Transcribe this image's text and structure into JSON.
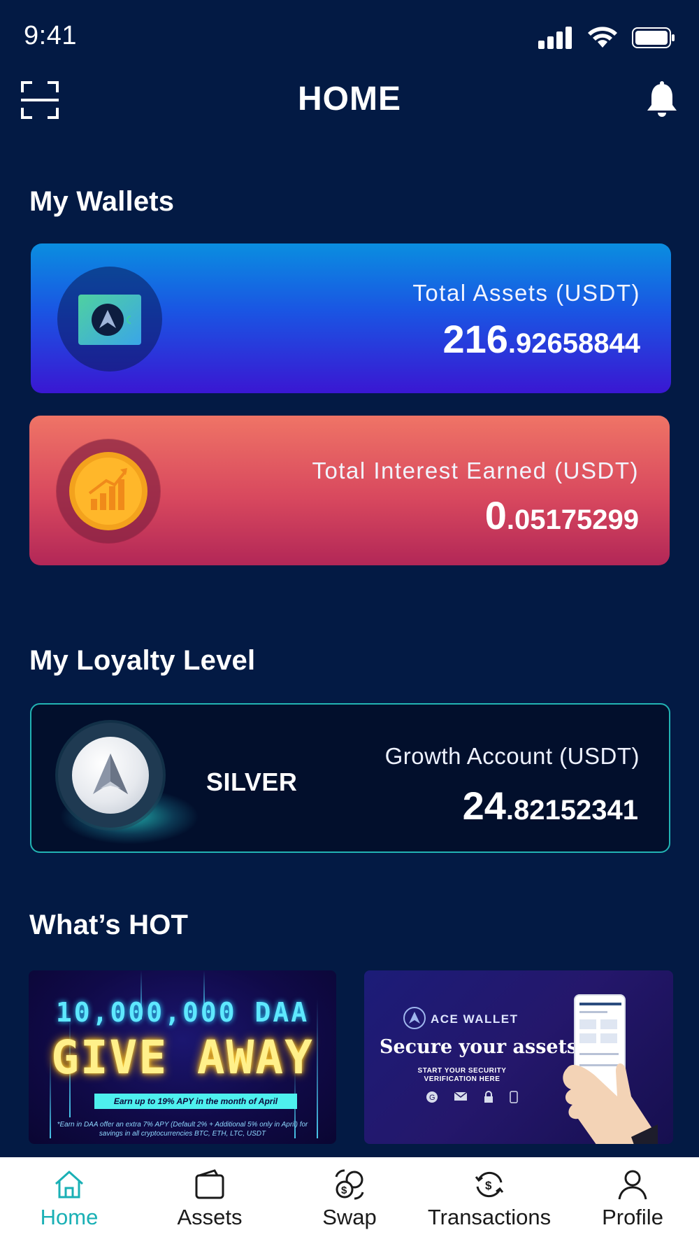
{
  "status_bar": {
    "time": "9:41"
  },
  "header": {
    "title": "HOME"
  },
  "sections": {
    "wallets_title": "My Wallets",
    "loyalty_title": "My Loyalty Level",
    "hot_title": "What’s HOT"
  },
  "wallets": {
    "total_assets": {
      "label": "Total Assets (USDT)",
      "int": "216",
      "dec": ".92658844"
    },
    "total_interest": {
      "label": "Total Interest Earned (USDT)",
      "int": "0",
      "dec": ".05175299"
    }
  },
  "loyalty": {
    "level": "SILVER",
    "label": "Growth Account (USDT)",
    "int": "24",
    "dec": ".82152341"
  },
  "hot": {
    "giveaway": {
      "top": "10,000,000 DAA",
      "main": "GIVE AWAY",
      "sub": "Earn up to 19% APY in the month of April",
      "note": "*Earn in DAA offer an extra 7% APY (Default 2% + Additional 5% only in April) for savings in all cryptocurrencies BTC, ETH, LTC, USDT"
    },
    "security": {
      "brand": "ACE WALLET",
      "headline": "Secure your assets.",
      "sub": "START YOUR SECURITY VERIFICATION HERE"
    }
  },
  "nav": {
    "items": [
      {
        "label": "Home",
        "icon": "home-icon",
        "active": true
      },
      {
        "label": "Assets",
        "icon": "wallet-icon"
      },
      {
        "label": "Swap",
        "icon": "swap-icon"
      },
      {
        "label": "Transactions",
        "icon": "transactions-icon"
      },
      {
        "label": "Profile",
        "icon": "profile-icon"
      }
    ]
  },
  "colors": {
    "background": "#031a44",
    "accent": "#1ab0b5",
    "assets_card_top": "#0a8ee0",
    "assets_card_bottom": "#3a17d2",
    "interest_card_top": "#ef7466",
    "interest_card_bottom": "#b22757"
  }
}
